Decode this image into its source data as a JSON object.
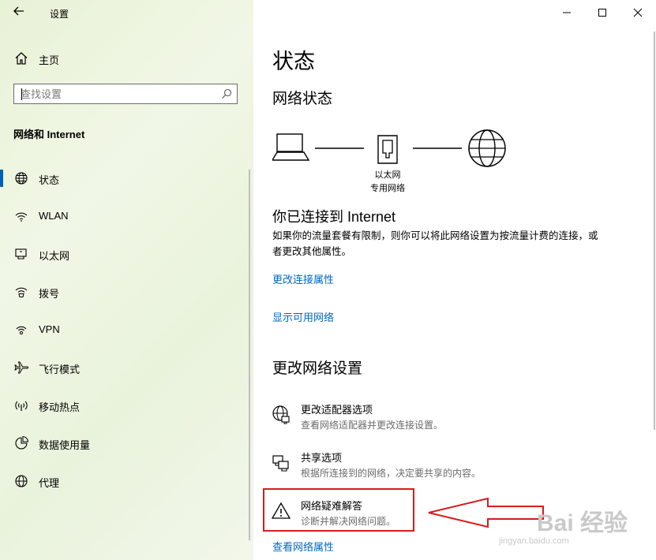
{
  "app": {
    "title": "设置"
  },
  "sidebar": {
    "home_label": "主页",
    "search_placeholder": "查找设置",
    "section_title": "网络和 Internet",
    "items": [
      {
        "label": "状态",
        "icon": "globe-icon",
        "active": true
      },
      {
        "label": "WLAN",
        "icon": "wifi-icon"
      },
      {
        "label": "以太网",
        "icon": "ethernet-icon"
      },
      {
        "label": "拨号",
        "icon": "dialup-icon"
      },
      {
        "label": "VPN",
        "icon": "vpn-icon"
      },
      {
        "label": "飞行模式",
        "icon": "airplane-icon"
      },
      {
        "label": "移动热点",
        "icon": "hotspot-icon"
      },
      {
        "label": "数据使用量",
        "icon": "data-usage-icon"
      },
      {
        "label": "代理",
        "icon": "proxy-globe-icon"
      }
    ]
  },
  "main": {
    "title": "状态",
    "network_status_heading": "网络状态",
    "diagram": {
      "adapter_label": "以太网",
      "network_label": "专用网络"
    },
    "connected_heading": "你已连接到 Internet",
    "connected_desc": "如果你的流量套餐有限制，则你可以将此网络设置为按流量计费的连接，或者更改其他属性。",
    "link_change_props": "更改连接属性",
    "link_show_networks": "显示可用网络",
    "change_settings_heading": "更改网络设置",
    "options": [
      {
        "title": "更改适配器选项",
        "subtitle": "查看网络适配器并更改连接设置。",
        "icon": "adapter-globe-icon"
      },
      {
        "title": "共享选项",
        "subtitle": "根据所连接到的网络，决定要共享的内容。",
        "icon": "sharing-icon"
      },
      {
        "title": "网络疑难解答",
        "subtitle": "诊断并解决网络问题。",
        "icon": "warning-icon"
      }
    ],
    "link_view_props": "查看网络属性"
  },
  "watermark": {
    "text": "Bai 经验",
    "url": "jingyan.baidu.com"
  },
  "colors": {
    "accent": "#0063b1",
    "link": "#0067c0",
    "highlight": "#d71d1d"
  }
}
